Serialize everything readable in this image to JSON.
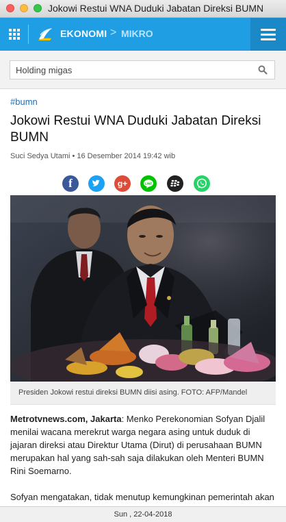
{
  "window": {
    "title": "Jokowi Restui WNA Duduki Jabatan Direksi BUMN"
  },
  "header": {
    "section": "EKONOMI",
    "separator": ">",
    "subsection": "MIKRO"
  },
  "search": {
    "value": "Holding migas"
  },
  "article": {
    "tag": "#bumn",
    "headline": "Jokowi Restui WNA Duduki Jabatan Direksi BUMN",
    "byline": "Suci Sedya Utami • 16 Desember 2014 19:42 wib",
    "caption": "Presiden Jokowi restui direksi BUMN diisi asing. FOTO: AFP/Mandel",
    "lead_source": "Metrotvnews.com, Jakarta",
    "lead_text": ": Menko Perekonomian Sofyan Djalil menilai wacana merekrut warga negara asing untuk duduk di jajaran direksi atau Direktur Utama (Dirut) di perusahaan BUMN merupakan hal yang sah-sah saja dilakukan oleh Menteri BUMN Rini Soemarno.",
    "paragraph2": "Sofyan mengatakan, tidak menutup kemungkinan pemerintah akan"
  },
  "share": {
    "icons": [
      "facebook-icon",
      "twitter-icon",
      "google-plus-icon",
      "line-icon",
      "blackberry-icon",
      "whatsapp-icon"
    ],
    "colors": {
      "facebook": "#3b5998",
      "twitter": "#1da1f2",
      "google_plus": "#dd4b39",
      "line": "#00c300",
      "blackberry": "#222222",
      "whatsapp": "#25d366"
    }
  },
  "status": {
    "date": "Sun , 22-04-2018"
  },
  "colors": {
    "header": "#1f9ee3",
    "menu_button": "#1b88c7",
    "tag": "#1f6fb5"
  }
}
